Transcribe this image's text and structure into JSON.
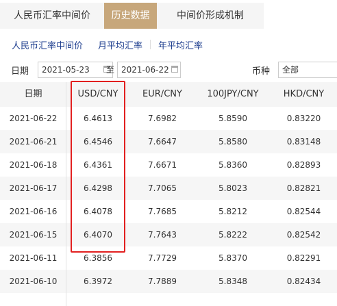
{
  "tabs": [
    {
      "label": "人民币汇率中间价"
    },
    {
      "label": "历史数据"
    },
    {
      "label": "中间价形成机制"
    }
  ],
  "subnav": [
    {
      "label": "人民币汇率中间价"
    },
    {
      "label": "月平均汇率"
    },
    {
      "label": "年平均汇率"
    }
  ],
  "filters": {
    "date_label": "日期",
    "start_date": "2021-05-23",
    "to_label": "至",
    "end_date": "2021-06-22",
    "currency_label": "币种",
    "currency_value": "全部"
  },
  "table": {
    "headers": [
      "日期",
      "USD/CNY",
      "EUR/CNY",
      "100JPY/CNY",
      "HKD/CNY"
    ],
    "rows": [
      [
        "2021-06-22",
        "6.4613",
        "7.6982",
        "5.8590",
        "0.83220"
      ],
      [
        "2021-06-21",
        "6.4546",
        "7.6647",
        "5.8580",
        "0.83148"
      ],
      [
        "2021-06-18",
        "6.4361",
        "7.6671",
        "5.8360",
        "0.82893"
      ],
      [
        "2021-06-17",
        "6.4298",
        "7.7065",
        "5.8023",
        "0.82821"
      ],
      [
        "2021-06-16",
        "6.4078",
        "7.7685",
        "5.8212",
        "0.82544"
      ],
      [
        "2021-06-15",
        "6.4070",
        "7.7643",
        "5.8222",
        "0.82542"
      ],
      [
        "2021-06-11",
        "6.3856",
        "7.7729",
        "5.8370",
        "0.82291"
      ],
      [
        "2021-06-10",
        "6.3972",
        "7.7889",
        "5.8348",
        "0.82434"
      ]
    ]
  },
  "colors": {
    "active_tab": "#c7a77b",
    "link": "#1f3f8f",
    "highlight_box": "#e21f1f"
  }
}
